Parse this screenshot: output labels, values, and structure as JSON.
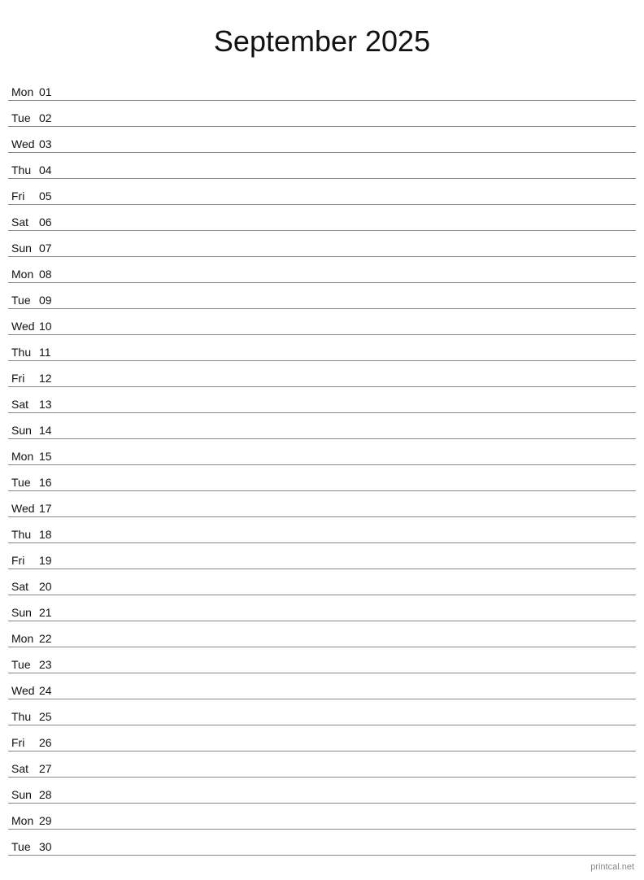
{
  "header": {
    "title": "September 2025"
  },
  "watermark": "printcal.net",
  "days": [
    {
      "name": "Mon",
      "number": "01"
    },
    {
      "name": "Tue",
      "number": "02"
    },
    {
      "name": "Wed",
      "number": "03"
    },
    {
      "name": "Thu",
      "number": "04"
    },
    {
      "name": "Fri",
      "number": "05"
    },
    {
      "name": "Sat",
      "number": "06"
    },
    {
      "name": "Sun",
      "number": "07"
    },
    {
      "name": "Mon",
      "number": "08"
    },
    {
      "name": "Tue",
      "number": "09"
    },
    {
      "name": "Wed",
      "number": "10"
    },
    {
      "name": "Thu",
      "number": "11"
    },
    {
      "name": "Fri",
      "number": "12"
    },
    {
      "name": "Sat",
      "number": "13"
    },
    {
      "name": "Sun",
      "number": "14"
    },
    {
      "name": "Mon",
      "number": "15"
    },
    {
      "name": "Tue",
      "number": "16"
    },
    {
      "name": "Wed",
      "number": "17"
    },
    {
      "name": "Thu",
      "number": "18"
    },
    {
      "name": "Fri",
      "number": "19"
    },
    {
      "name": "Sat",
      "number": "20"
    },
    {
      "name": "Sun",
      "number": "21"
    },
    {
      "name": "Mon",
      "number": "22"
    },
    {
      "name": "Tue",
      "number": "23"
    },
    {
      "name": "Wed",
      "number": "24"
    },
    {
      "name": "Thu",
      "number": "25"
    },
    {
      "name": "Fri",
      "number": "26"
    },
    {
      "name": "Sat",
      "number": "27"
    },
    {
      "name": "Sun",
      "number": "28"
    },
    {
      "name": "Mon",
      "number": "29"
    },
    {
      "name": "Tue",
      "number": "30"
    }
  ]
}
